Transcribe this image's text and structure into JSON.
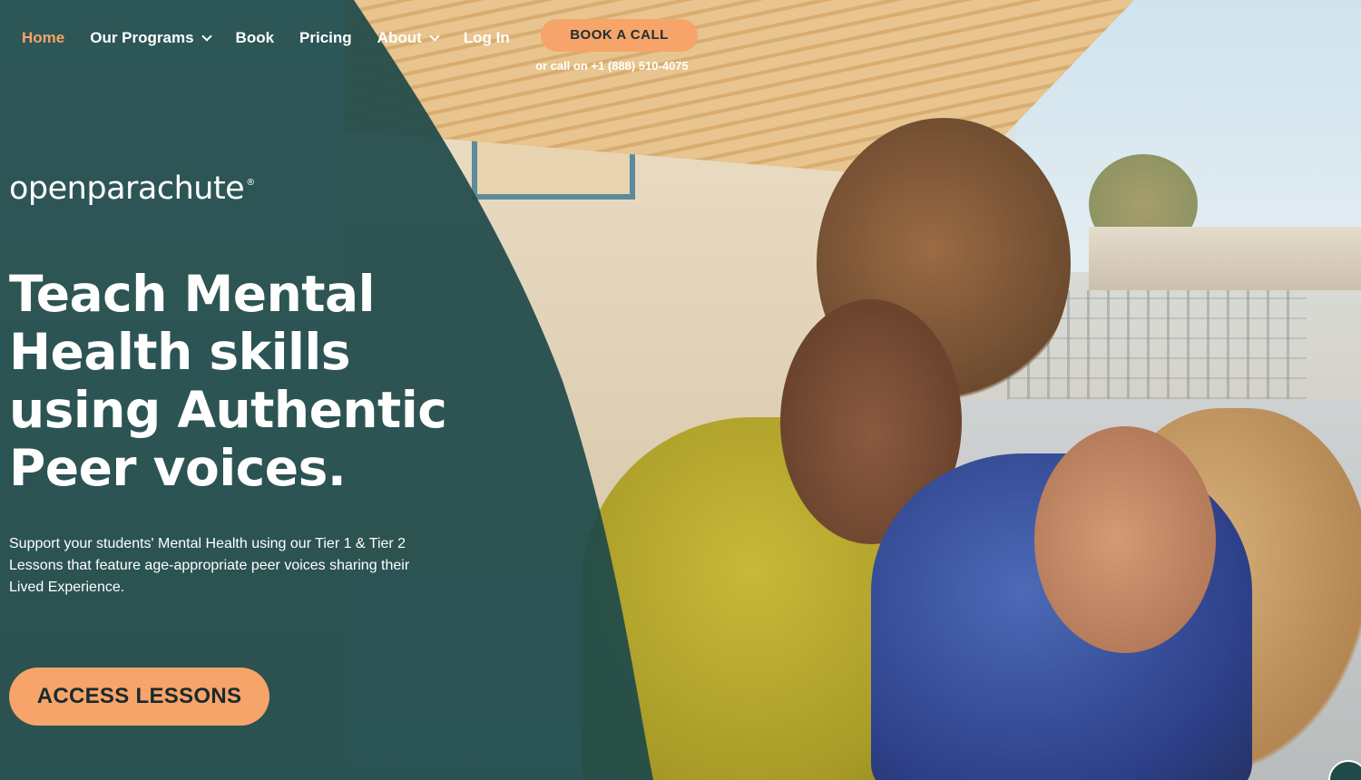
{
  "nav": {
    "items": [
      {
        "label": "Home",
        "active": true,
        "dropdown": false
      },
      {
        "label": "Our Programs",
        "active": false,
        "dropdown": true
      },
      {
        "label": "Book",
        "active": false,
        "dropdown": false
      },
      {
        "label": "Pricing",
        "active": false,
        "dropdown": false
      },
      {
        "label": "About",
        "active": false,
        "dropdown": true
      },
      {
        "label": "Log In",
        "active": false,
        "dropdown": false
      }
    ],
    "book_call_label": "BOOK A CALL",
    "call_text": "or call on +1 (888) 510-4075"
  },
  "brand": {
    "logo_text": "openparachute",
    "logo_mark": "®"
  },
  "hero": {
    "headline_lines": [
      "Teach Mental",
      "Health skills",
      "using Authentic",
      "Peer voices."
    ],
    "subtext": "Support your students' Mental Health using our Tier 1 & Tier 2 Lessons that feature age-appropriate peer voices sharing their Lived Experience.",
    "cta_label": "ACCESS LESSONS"
  },
  "colors": {
    "accent": "#f6a46a",
    "overlay": "#1f4a4a",
    "text": "#ffffff"
  },
  "icons": {
    "dropdown": "chevron-down-icon",
    "chat": "chat-icon"
  }
}
